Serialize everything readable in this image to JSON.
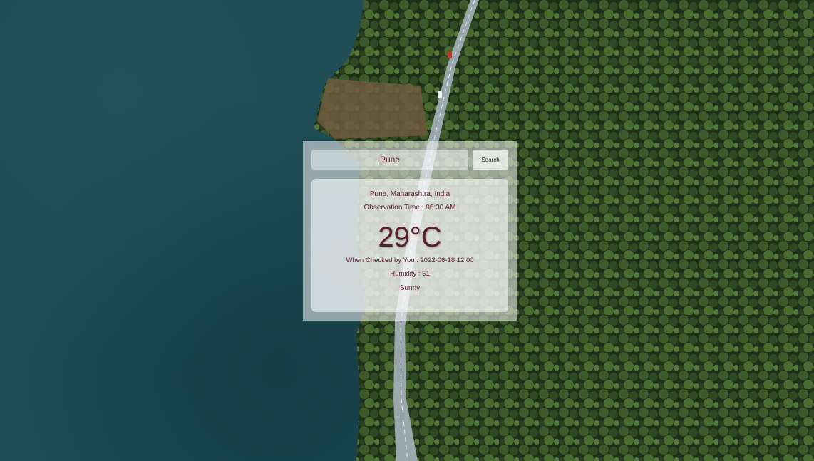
{
  "search": {
    "value": "Pune",
    "button_label": "Search"
  },
  "weather": {
    "location": "Pune, Maharashtra, India",
    "observation_time": "Observation Time : 06:30 AM",
    "temperature": "29°C",
    "checked_time": "When Checked by You : 2022-06-18 12:00",
    "humidity": "Humidity : 51",
    "condition": "Sunny"
  },
  "colors": {
    "text": "#5a1e28",
    "water": "#1f4c55",
    "forest": "#2b3d22"
  }
}
